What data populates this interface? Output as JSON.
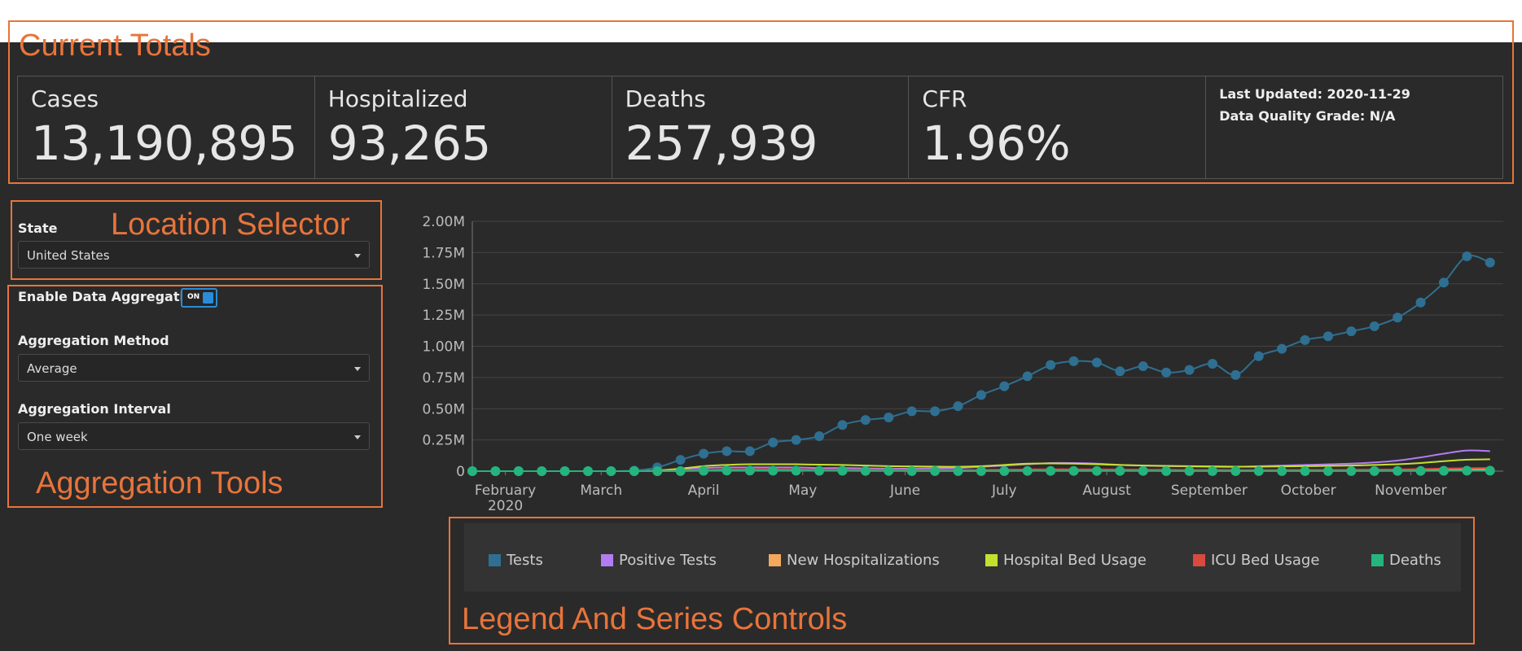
{
  "annotations": {
    "current_totals": "Current Totals",
    "location_selector": "Location Selector",
    "aggregation_tools": "Aggregation Tools",
    "legend_controls": "Legend And Series Controls"
  },
  "totals": {
    "cases_label": "Cases",
    "cases_value": "13,190,895",
    "hospitalized_label": "Hospitalized",
    "hospitalized_value": "93,265",
    "deaths_label": "Deaths",
    "deaths_value": "257,939",
    "cfr_label": "CFR",
    "cfr_value": "1.96%",
    "last_updated": "Last Updated: 2020-11-29",
    "data_quality": "Data Quality Grade: N/A"
  },
  "location": {
    "label": "State",
    "value": "United States"
  },
  "aggregation": {
    "enable_label": "Enable Data Aggregation",
    "toggle_state": "ON",
    "method_label": "Aggregation Method",
    "method_value": "Average",
    "interval_label": "Aggregation Interval",
    "interval_value": "One week"
  },
  "legend": [
    {
      "name": "Tests",
      "color": "#2f6f91"
    },
    {
      "name": "Positive Tests",
      "color": "#b47cf2"
    },
    {
      "name": "New Hospitalizations",
      "color": "#f2a95e"
    },
    {
      "name": "Hospital Bed Usage",
      "color": "#c7e02e"
    },
    {
      "name": "ICU Bed Usage",
      "color": "#d84a3d"
    },
    {
      "name": "Deaths",
      "color": "#25b47e"
    }
  ],
  "chart_data": {
    "type": "line",
    "x_tick_labels": [
      "February",
      "March",
      "April",
      "May",
      "June",
      "July",
      "August",
      "September",
      "October",
      "November"
    ],
    "x_year_label": "2020",
    "y_tick_labels": [
      "0",
      "0.25M",
      "0.50M",
      "0.75M",
      "1.00M",
      "1.25M",
      "1.50M",
      "1.75M",
      "2.00M"
    ],
    "ylim": [
      0,
      2000000
    ],
    "x": [
      "2020-01-22",
      "2020-01-29",
      "2020-02-05",
      "2020-02-12",
      "2020-02-19",
      "2020-02-26",
      "2020-03-04",
      "2020-03-11",
      "2020-03-18",
      "2020-03-25",
      "2020-04-01",
      "2020-04-08",
      "2020-04-15",
      "2020-04-22",
      "2020-04-29",
      "2020-05-06",
      "2020-05-13",
      "2020-05-20",
      "2020-05-27",
      "2020-06-03",
      "2020-06-10",
      "2020-06-17",
      "2020-06-24",
      "2020-07-01",
      "2020-07-08",
      "2020-07-15",
      "2020-07-22",
      "2020-07-29",
      "2020-08-05",
      "2020-08-12",
      "2020-08-19",
      "2020-08-26",
      "2020-09-02",
      "2020-09-09",
      "2020-09-16",
      "2020-09-23",
      "2020-09-30",
      "2020-10-07",
      "2020-10-14",
      "2020-10-21",
      "2020-10-28",
      "2020-11-04",
      "2020-11-11",
      "2020-11-18",
      "2020-11-25"
    ],
    "series": [
      {
        "name": "Tests",
        "color": "#2f6f91",
        "markers": true,
        "values": [
          0,
          0,
          0,
          0,
          0,
          0,
          0,
          5000,
          30000,
          90000,
          140000,
          160000,
          160000,
          230000,
          250000,
          280000,
          370000,
          410000,
          430000,
          480000,
          480000,
          520000,
          610000,
          680000,
          760000,
          850000,
          880000,
          870000,
          800000,
          840000,
          790000,
          810000,
          860000,
          770000,
          920000,
          980000,
          1050000,
          1080000,
          1120000,
          1160000,
          1230000,
          1350000,
          1510000,
          1720000,
          1670000
        ]
      },
      {
        "name": "Positive Tests",
        "color": "#b47cf2",
        "markers": false,
        "values": [
          0,
          0,
          0,
          0,
          0,
          0,
          0,
          1000,
          5000,
          15000,
          25000,
          30000,
          30000,
          30000,
          30000,
          25000,
          25000,
          22000,
          20000,
          20000,
          22000,
          25000,
          35000,
          45000,
          55000,
          65000,
          65000,
          60000,
          50000,
          45000,
          40000,
          38000,
          35000,
          35000,
          40000,
          45000,
          50000,
          55000,
          60000,
          70000,
          85000,
          110000,
          140000,
          165000,
          160000
        ]
      },
      {
        "name": "New Hospitalizations",
        "color": "#f2a95e",
        "markers": false,
        "values": [
          0,
          0,
          0,
          0,
          0,
          0,
          0,
          0,
          1000,
          3000,
          5000,
          5000,
          5000,
          5000,
          4000,
          4000,
          3000,
          3000,
          3000,
          3000,
          3000,
          3000,
          4000,
          5000,
          6000,
          6000,
          6000,
          5000,
          5000,
          4000,
          4000,
          4000,
          4000,
          4000,
          4000,
          4000,
          5000,
          5000,
          5000,
          6000,
          7000,
          9000,
          11000,
          13000,
          14000
        ]
      },
      {
        "name": "Hospital Bed Usage",
        "color": "#c7e02e",
        "markers": false,
        "values": [
          0,
          0,
          0,
          0,
          0,
          0,
          0,
          0,
          5000,
          20000,
          40000,
          50000,
          55000,
          55000,
          55000,
          52000,
          50000,
          45000,
          40000,
          38000,
          36000,
          35000,
          40000,
          50000,
          60000,
          62000,
          60000,
          55000,
          50000,
          45000,
          42000,
          40000,
          38000,
          36000,
          36000,
          38000,
          40000,
          42000,
          45000,
          50000,
          55000,
          65000,
          80000,
          92000,
          95000
        ]
      },
      {
        "name": "ICU Bed Usage",
        "color": "#d84a3d",
        "markers": false,
        "values": [
          0,
          0,
          0,
          0,
          0,
          0,
          0,
          0,
          1000,
          5000,
          10000,
          14000,
          15000,
          15000,
          14000,
          13000,
          12000,
          11000,
          10000,
          9000,
          9000,
          9000,
          10000,
          12000,
          14000,
          15000,
          15000,
          14000,
          13000,
          12000,
          11000,
          10000,
          10000,
          9000,
          9000,
          9000,
          10000,
          10000,
          11000,
          12000,
          14000,
          17000,
          21000,
          24000,
          25000
        ]
      },
      {
        "name": "Deaths",
        "color": "#25b47e",
        "markers": true,
        "values": [
          0,
          0,
          0,
          0,
          0,
          0,
          0,
          0,
          100,
          1000,
          3000,
          5000,
          5000,
          4000,
          4000,
          3000,
          3000,
          2000,
          2000,
          1000,
          1000,
          1000,
          1000,
          1000,
          2000,
          2000,
          2000,
          2000,
          2000,
          2000,
          1000,
          1000,
          1000,
          1000,
          1000,
          1000,
          1000,
          1000,
          1000,
          1000,
          2000,
          2000,
          3000,
          4000,
          4000
        ]
      }
    ]
  }
}
